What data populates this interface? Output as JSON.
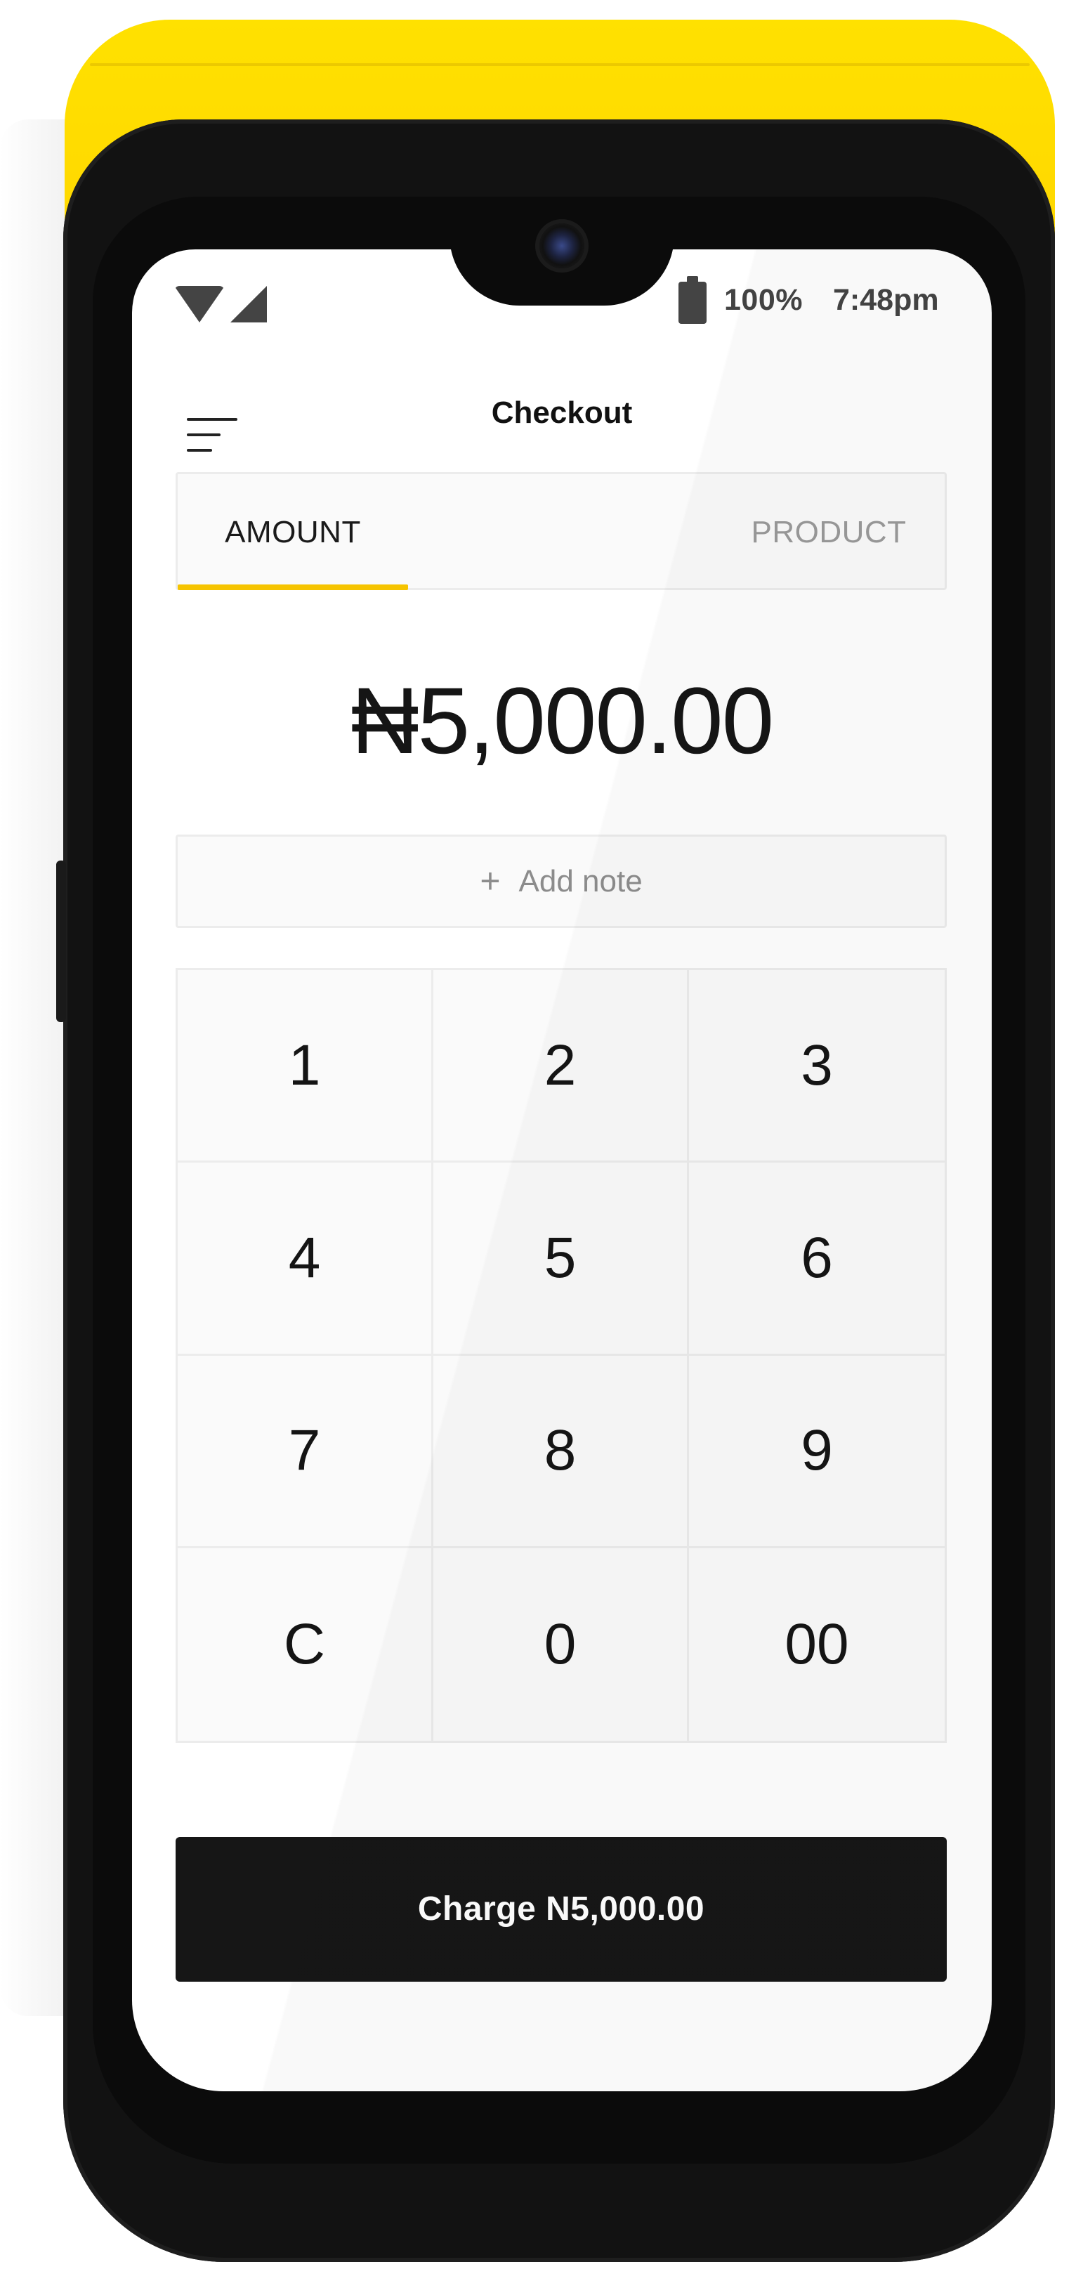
{
  "status_bar": {
    "battery": "100%",
    "time": "7:48pm"
  },
  "header": {
    "title": "Checkout"
  },
  "tabs": [
    {
      "label": "AMOUNT",
      "active": true
    },
    {
      "label": "PRODUCT",
      "active": false
    }
  ],
  "amount": {
    "display": "₦5,000.00"
  },
  "note": {
    "plus": "+",
    "label": "Add note"
  },
  "keypad": {
    "keys": [
      "1",
      "2",
      "3",
      "4",
      "5",
      "6",
      "7",
      "8",
      "9",
      "C",
      "0",
      "00"
    ]
  },
  "charge": {
    "label": "Charge N5,000.00"
  },
  "colors": {
    "accent": "#f6c400",
    "device_cap": "#ffdd00",
    "button_bg": "#161616"
  },
  "icons": [
    "wifi-icon",
    "signal-icon",
    "battery-icon",
    "menu-icon",
    "plus-icon"
  ]
}
